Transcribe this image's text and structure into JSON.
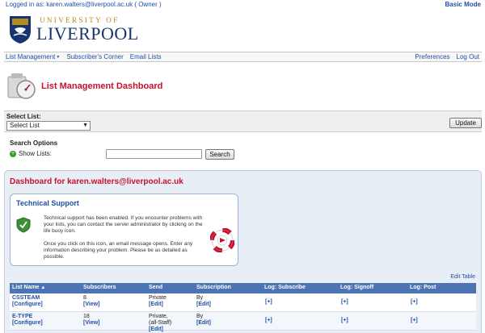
{
  "header": {
    "logged_in_text": "Logged in as: karen.walters@liverpool.ac.uk ( Owner )",
    "basic_mode": "Basic Mode"
  },
  "logo": {
    "line1": "UNIVERSITY OF",
    "line2": "LIVERPOOL"
  },
  "nav": {
    "list_management": "List Management",
    "subscribers_corner": "Subscriber's Corner",
    "email_lists": "Email Lists",
    "preferences": "Preferences",
    "logout": "Log Out"
  },
  "page": {
    "title": "List Management Dashboard"
  },
  "select_list": {
    "label": "Select List:",
    "selected": "Select List",
    "update_button": "Update"
  },
  "search": {
    "title": "Search Options",
    "show_lists_label": "Show Lists:",
    "input_value": "",
    "button": "Search"
  },
  "dashboard": {
    "title": "Dashboard for karen.walters@liverpool.ac.uk",
    "support": {
      "title": "Technical Support",
      "para1": "Technical support has been enabled. If you encounter problems with your lists, you can contact the server administrator by clicking on the life buoy icon.",
      "para2": "Once you click on this icon, an email message opens. Enter any information describing your problem. Please be as detailed as possible."
    },
    "edit_table": "Edit Table",
    "columns": {
      "list_name": "List Name",
      "subscribers": "Subscribers",
      "send": "Send",
      "subscription": "Subscription",
      "log_subscribe": "Log: Subscribe",
      "log_signoff": "Log: Signoff",
      "log_post": "Log: Post"
    },
    "rows": [
      {
        "name": "CSSTEAM",
        "configure": "[Configure]",
        "subscribers": "8",
        "view": "[View]",
        "send": "Private",
        "send_edit": "[Edit]",
        "subscription": "By",
        "subscription_edit": "[Edit]",
        "log_subscribe": "[+]",
        "log_signoff": "[+]",
        "log_post": "[+]"
      },
      {
        "name": "E-TYPE",
        "configure": "[Configure]",
        "subscribers": "18",
        "view": "[View]",
        "send": "Private,",
        "send_line2": "(all-Staff)",
        "send_edit": "[Edit]",
        "subscription": "By",
        "subscription_edit": "[Edit]",
        "log_subscribe": "[+]",
        "log_signoff": "[+]",
        "log_post": "[+]"
      }
    ]
  },
  "colors": {
    "brand_red": "#c8102e",
    "link_blue": "#1f4fa8",
    "table_header": "#4c73b3",
    "logo_navy": "#17346e",
    "logo_gold": "#b18b1c"
  },
  "icons": [
    "university-crest-icon",
    "dashboard-gauge-icon",
    "chevron-down-icon",
    "show-lists-plus-icon",
    "shield-icon",
    "life-buoy-icon",
    "sort-ascending-icon"
  ]
}
